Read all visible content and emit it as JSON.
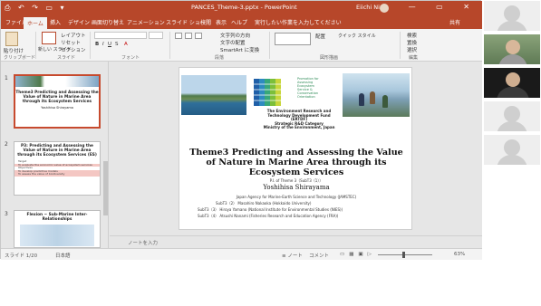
{
  "window": {
    "title": "PANCES_Theme-3.pptx - PowerPoint",
    "user_name": "Eiichi Niwa",
    "quick_access": "⎙ ↶ ↷ ▭ ▾",
    "window_controls": "— ▭ ✕"
  },
  "ribbon_tabs": [
    "ファイル",
    "ホーム",
    "挿入",
    "デザイン",
    "画面切り替え",
    "アニメーション",
    "スライド ショー",
    "校閲",
    "表示",
    "ヘルプ",
    "実行したい作業を入力してください",
    "共有"
  ],
  "ribbon": {
    "paste": "貼り付け",
    "new_slide": "新しい\nスライド",
    "layout": "レイアウト",
    "reset": "リセット",
    "section": "セクション",
    "font_value": "",
    "size_value": "",
    "text_dir": "文字列の方向",
    "align_text": "文字の配置",
    "smartart": "SmartArt に変換",
    "arrange": "配置",
    "quick_styles": "クイック\nスタイル",
    "find": "検索",
    "replace": "置換",
    "select": "選択",
    "groups": {
      "clipboard": "クリップボード",
      "slides": "スライド",
      "font": "フォント",
      "paragraph": "段落",
      "drawing": "図形描画",
      "editing": "編集"
    }
  },
  "thumbnails": [
    {
      "number": "1",
      "title": "Theme3 Predicting and Assessing the Value of Nature in Marine Area through its Ecosystem Services",
      "subtitle": "Yoshihisa Shirayama"
    },
    {
      "number": "2",
      "title": "P3: Predicting and Assessing the Value of Nature in Marine Area through its Ecosystem Services (ES)",
      "lines": [
        "Target",
        "To evaluate the economic value of ecosystem services",
        "Objectives",
        "To develop predictive models",
        "To assess the value of biodiversity"
      ]
    },
    {
      "number": "3",
      "title": "Flexion ~ Sub-Marine Inter-Relationships"
    }
  ],
  "slide": {
    "erf_caption_lines": [
      "The Environment Research and",
      "Technology Development Fund",
      "(ERTDF)",
      "Strategic R&D Category",
      "Ministry of the Environment, Japan"
    ],
    "erf_text": "Promotion for\nAssessing\nEcosystem\nService &\nConservation\nOrientation",
    "title": "Theme3  Predicting and Assessing the Value of Nature in Marine Area through its Ecosystem Services",
    "pi_line": "P.I. of Theme 3（SubT3（1））",
    "author": "Yoshihisa Shirayama",
    "affiliation_1": "Japan Agency for Marine-Earth Science and Technology (JAMSTEC)",
    "affiliation_2": "SubT3（2）    Masahiro Nakaoka (Hokkaido University)",
    "affiliation_3": "SubT3（3）    Hiroya Yamano (National Institute for Environmental Studies (NIES))",
    "affiliation_4": "SubT3（4）    Atsushi Nanami (Fisheries Research and Education Agency (FRA))"
  },
  "notes_placeholder": "ノートを入力",
  "status": {
    "slide_counter": "スライド 1/20",
    "language": "日本語",
    "notes_btn": "≡ ノート",
    "comments_btn": "コメント",
    "zoom": "63%"
  }
}
